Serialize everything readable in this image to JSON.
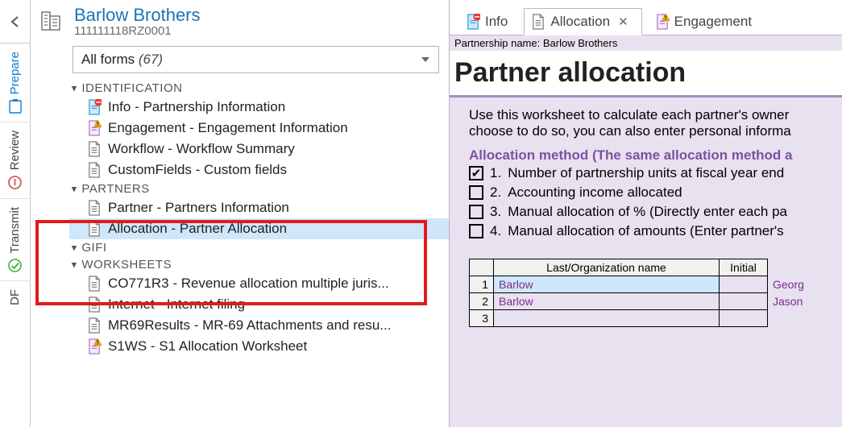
{
  "rail": {
    "items": [
      {
        "label": "Prepare"
      },
      {
        "label": "Review"
      },
      {
        "label": "Transmit"
      },
      {
        "label": "DF"
      }
    ]
  },
  "header": {
    "title": "Barlow Brothers",
    "sub": "111111118RZ0001"
  },
  "formsDropdown": {
    "label": "All forms",
    "count": "(67)"
  },
  "groups": [
    {
      "name": "IDENTIFICATION",
      "items": [
        {
          "icon": "doc-minus",
          "label": "Info - Partnership Information"
        },
        {
          "icon": "doc-warn",
          "label": "Engagement - Engagement Information"
        },
        {
          "icon": "doc",
          "label": "Workflow - Workflow Summary"
        },
        {
          "icon": "doc",
          "label": "CustomFields - Custom fields"
        }
      ]
    },
    {
      "name": "PARTNERS",
      "items": [
        {
          "icon": "doc",
          "label": "Partner - Partners Information"
        },
        {
          "icon": "doc",
          "label": "Allocation - Partner Allocation",
          "selected": true
        }
      ]
    },
    {
      "name": "GIFI",
      "items": []
    },
    {
      "name": "WORKSHEETS",
      "items": [
        {
          "icon": "doc",
          "label": "CO771R3 - Revenue allocation multiple juris..."
        },
        {
          "icon": "doc",
          "label": "Internet - Internet filing"
        },
        {
          "icon": "doc",
          "label": "MR69Results - MR-69 Attachments and resu..."
        },
        {
          "icon": "doc-warn",
          "label": "S1WS - S1 Allocation Worksheet"
        }
      ]
    }
  ],
  "tabs": [
    {
      "icon": "doc-minus",
      "label": "Info"
    },
    {
      "icon": "doc",
      "label": "Allocation",
      "active": true,
      "closable": true
    },
    {
      "icon": "doc-warn",
      "label": "Engagement"
    }
  ],
  "doc": {
    "metaLabel": "Partnership name:",
    "metaValue": "Barlow Brothers",
    "title": "Partner allocation",
    "intro1": "Use this worksheet to calculate each partner's owner",
    "intro2": "choose to do so, you can also enter personal informa",
    "allocHeader": "Allocation method (The same allocation method a",
    "options": [
      {
        "num": "1.",
        "label": "Number of partnership units at fiscal year end",
        "checked": true
      },
      {
        "num": "2.",
        "label": "Accounting income allocated",
        "checked": false
      },
      {
        "num": "3.",
        "label": "Manual allocation of % (Directly enter each pa",
        "checked": false
      },
      {
        "num": "4.",
        "label": "Manual allocation of amounts (Enter partner's",
        "checked": false
      }
    ],
    "table": {
      "headers": {
        "name": "Last/Organization name",
        "initial": "Initial"
      },
      "rows": [
        {
          "n": "1",
          "name": "Barlow",
          "first": "Georg",
          "sel": true
        },
        {
          "n": "2",
          "name": "Barlow",
          "first": "Jason"
        },
        {
          "n": "3",
          "name": "",
          "first": ""
        }
      ]
    }
  }
}
